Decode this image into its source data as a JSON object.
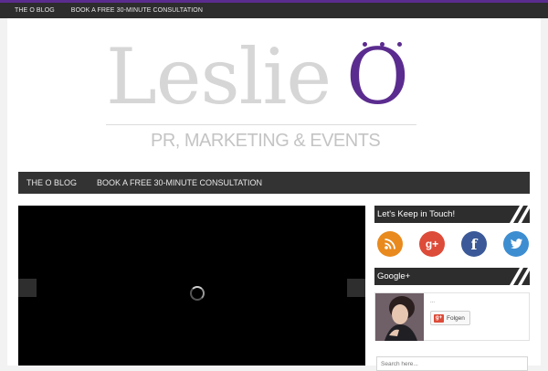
{
  "top_nav": {
    "items": [
      "THE O BLOG",
      "BOOK A FREE 30-MINUTE CONSULTATION"
    ]
  },
  "logo": {
    "main_text": "Leslie",
    "o_letter": "O",
    "tagline": "PR, MARKETING & EVENTS"
  },
  "main_nav": {
    "items": [
      "THE O BLOG",
      "BOOK A FREE 30-MINUTE CONSULTATION"
    ]
  },
  "sidebar": {
    "keep_in_touch_title": "Let's Keep in Touch!",
    "social_icons": [
      "rss-icon",
      "google-plus-icon",
      "facebook-icon",
      "twitter-icon"
    ],
    "google_plus_title": "Google+",
    "google_plus_card": {
      "name_placeholder": "...",
      "follow_label": "Folgen",
      "gplus_badge": "g+"
    },
    "search_placeholder": "Search here..."
  },
  "colors": {
    "brand_purple": "#5b2c8f",
    "bar_dark": "#2d2d2d",
    "rss": "#e98a1e",
    "google_plus": "#dd4b39",
    "facebook": "#3b5998",
    "twitter": "#3d8dd1"
  }
}
